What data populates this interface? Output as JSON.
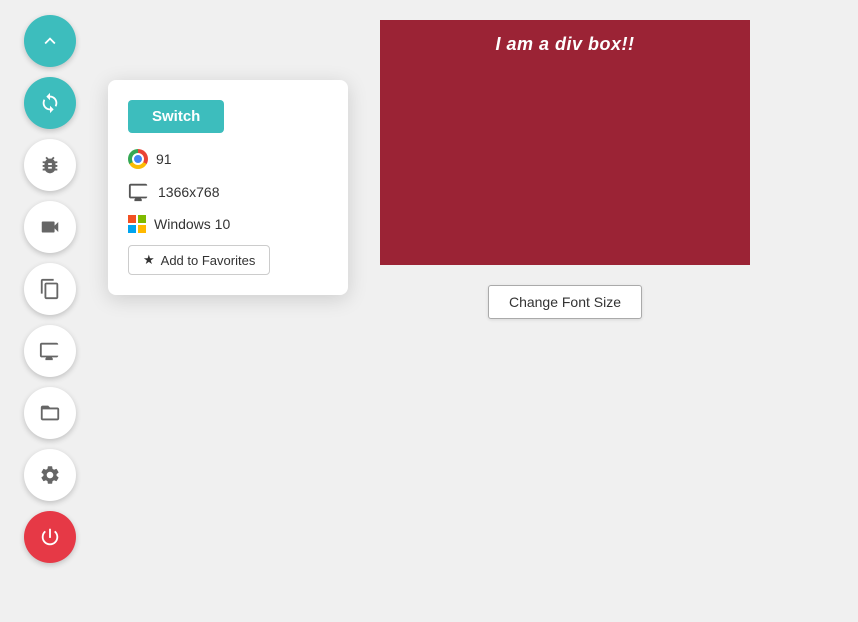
{
  "sidebar": {
    "buttons": [
      {
        "id": "chevron-up",
        "icon": "▲",
        "type": "teal",
        "label": "scroll-up-button"
      },
      {
        "id": "sync",
        "icon": "sync",
        "type": "active-sync",
        "label": "sync-button"
      },
      {
        "id": "bug",
        "icon": "bug",
        "type": "normal",
        "label": "bug-button"
      },
      {
        "id": "video",
        "icon": "video",
        "type": "normal",
        "label": "video-button"
      },
      {
        "id": "copy",
        "icon": "copy",
        "type": "normal",
        "label": "copy-button"
      },
      {
        "id": "monitor",
        "icon": "monitor",
        "type": "normal",
        "label": "monitor-button"
      },
      {
        "id": "folder",
        "icon": "folder",
        "type": "normal",
        "label": "folder-button"
      },
      {
        "id": "settings",
        "icon": "gear",
        "type": "normal",
        "label": "settings-button"
      },
      {
        "id": "power",
        "icon": "power",
        "type": "red",
        "label": "power-button"
      }
    ]
  },
  "popup": {
    "switch_label": "Switch",
    "chrome_version": "91",
    "screen_resolution": "1366x768",
    "os": "Windows 10",
    "add_favorites_label": "Add to Favorites"
  },
  "main": {
    "div_box_text": "I am a div box!!",
    "change_font_label": "Change Font Size"
  }
}
